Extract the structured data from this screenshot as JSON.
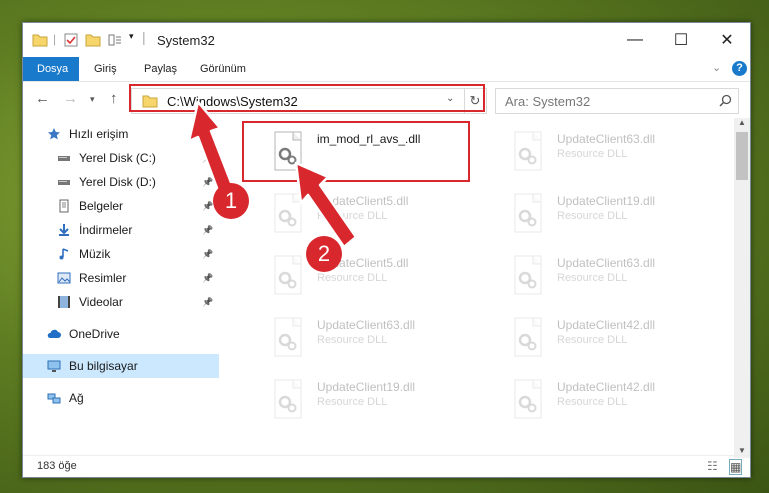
{
  "window": {
    "title": "System32",
    "minimize": "—",
    "maximize": "☐",
    "close": "✕"
  },
  "ribbon": {
    "tabs": [
      "Dosya",
      "Giriş",
      "Paylaş",
      "Görünüm"
    ],
    "help": "?"
  },
  "address": {
    "path": "C:\\Windows\\System32",
    "search_placeholder": "Ara: System32"
  },
  "nav": {
    "items": [
      {
        "label": "Hızlı erişim",
        "icon": "star-icon"
      },
      {
        "label": "Yerel Disk (C:)",
        "icon": "drive-icon",
        "pinned": true
      },
      {
        "label": "Yerel Disk (D:)",
        "icon": "drive-icon",
        "pinned": true
      },
      {
        "label": "Belgeler",
        "icon": "document-icon",
        "pinned": true
      },
      {
        "label": "İndirmeler",
        "icon": "download-icon",
        "pinned": true
      },
      {
        "label": "Müzik",
        "icon": "music-icon",
        "pinned": true
      },
      {
        "label": "Resimler",
        "icon": "pictures-icon",
        "pinned": true
      },
      {
        "label": "Videolar",
        "icon": "video-icon",
        "pinned": true
      },
      {
        "label": "OneDrive",
        "icon": "cloud-icon"
      },
      {
        "label": "Bu bilgisayar",
        "icon": "computer-icon",
        "selected": true
      },
      {
        "label": "Ağ",
        "icon": "network-icon"
      }
    ]
  },
  "files": [
    {
      "name": "im_mod_rl_avs_.dll",
      "type": "",
      "faded": false
    },
    {
      "name": "UpdateClient63.dll",
      "type": "Resource DLL",
      "faded": true
    },
    {
      "name": "UpdateClient5.dll",
      "type": "Resource DLL",
      "faded": true
    },
    {
      "name": "UpdateClient19.dll",
      "type": "Resource DLL",
      "faded": true
    },
    {
      "name": "UpdateClient5.dll",
      "type": "Resource DLL",
      "faded": true
    },
    {
      "name": "UpdateClient63.dll",
      "type": "Resource DLL",
      "faded": true
    },
    {
      "name": "UpdateClient63.dll",
      "type": "Resource DLL",
      "faded": true
    },
    {
      "name": "UpdateClient42.dll",
      "type": "Resource DLL",
      "faded": true
    },
    {
      "name": "UpdateClient19.dll",
      "type": "Resource DLL",
      "faded": true
    },
    {
      "name": "UpdateClient42.dll",
      "type": "Resource DLL",
      "faded": true
    }
  ],
  "status": {
    "item_count": "183 öğe"
  },
  "annotations": {
    "step1": "1",
    "step2": "2",
    "color": "#d9272e"
  }
}
